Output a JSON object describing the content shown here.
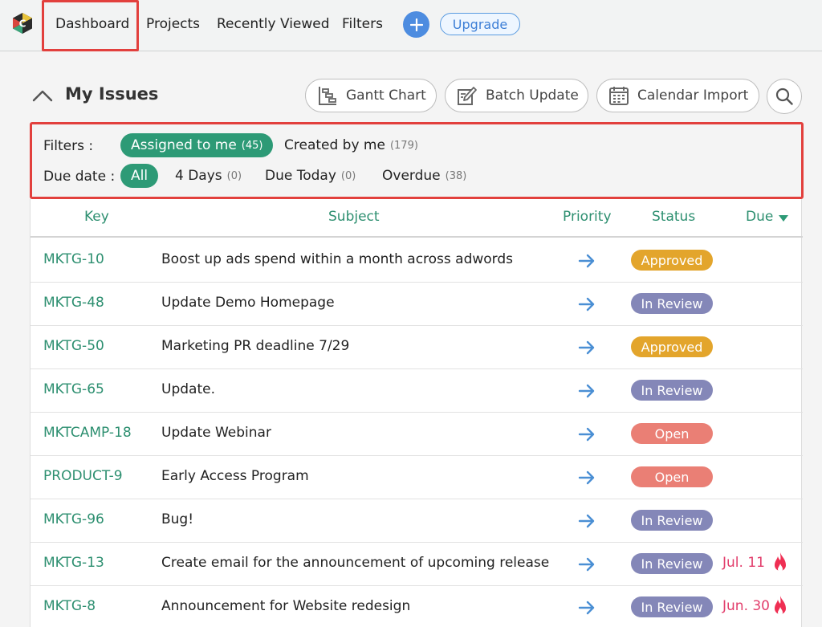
{
  "nav": {
    "items": [
      "Dashboard",
      "Projects",
      "Recently Viewed",
      "Filters"
    ],
    "upgrade_label": "Upgrade"
  },
  "header": {
    "title": "My Issues",
    "buttons": {
      "gantt": "Gantt Chart",
      "batch": "Batch Update",
      "calendar": "Calendar Import"
    }
  },
  "filters": {
    "label": "Filters :",
    "assigned": {
      "label": "Assigned to me",
      "count": "(45)"
    },
    "created": {
      "label": "Created by me",
      "count": "(179)"
    },
    "due_label": "Due date :",
    "all": "All",
    "four_days": {
      "label": "4 Days",
      "count": "(0)"
    },
    "due_today": {
      "label": "Due Today",
      "count": "(0)"
    },
    "overdue": {
      "label": "Overdue",
      "count": "(38)"
    }
  },
  "table": {
    "columns": {
      "key": "Key",
      "subject": "Subject",
      "priority": "Priority",
      "status": "Status",
      "due": "Due"
    },
    "rows": [
      {
        "key": "MKTG-10",
        "subject": "Boost up ads spend within a month across adwords",
        "status": "Approved",
        "due": ""
      },
      {
        "key": "MKTG-48",
        "subject": "Update Demo Homepage",
        "status": "In Review",
        "due": ""
      },
      {
        "key": "MKTG-50",
        "subject": "Marketing PR deadline 7/29",
        "status": "Approved",
        "due": ""
      },
      {
        "key": "MKTG-65",
        "subject": "Update.",
        "status": "In Review",
        "due": ""
      },
      {
        "key": "MKTCAMP-18",
        "subject": "Update Webinar",
        "status": "Open",
        "due": ""
      },
      {
        "key": "PRODUCT-9",
        "subject": "Early Access Program",
        "status": "Open",
        "due": ""
      },
      {
        "key": "MKTG-96",
        "subject": "Bug!",
        "status": "In Review",
        "due": ""
      },
      {
        "key": "MKTG-13",
        "subject": "Create email for the announcement of upcoming release",
        "status": "In Review",
        "due": "Jul. 11"
      },
      {
        "key": "MKTG-8",
        "subject": "Announcement for Website redesign",
        "status": "In Review",
        "due": "Jun. 30"
      }
    ]
  },
  "colors": {
    "accent_green": "#2d9a76",
    "approved": "#e3a52c",
    "in_review": "#8487b8",
    "open": "#ea7f75",
    "priority_arrow": "#4a8fd4",
    "overdue_text": "#e23d6b"
  }
}
